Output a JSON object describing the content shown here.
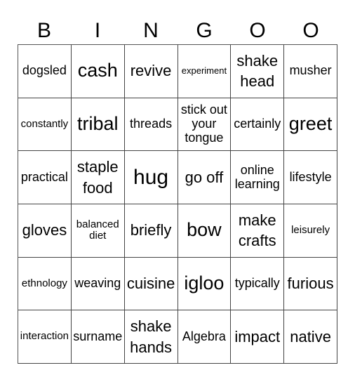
{
  "header": [
    "B",
    "I",
    "N",
    "G",
    "O",
    "O"
  ],
  "cells": [
    [
      "dogsled",
      "cash",
      "revive",
      "experiment",
      "shake head",
      "musher"
    ],
    [
      "constantly",
      "tribal",
      "threads",
      "stick out your tongue",
      "certainly",
      "greet"
    ],
    [
      "practical",
      "staple food",
      "hug",
      "go off",
      "online learning",
      "lifestyle"
    ],
    [
      "gloves",
      "balanced diet",
      "briefly",
      "bow",
      "make crafts",
      "leisurely"
    ],
    [
      "ethnology",
      "weaving",
      "cuisine",
      "igloo",
      "typically",
      "furious"
    ],
    [
      "interaction",
      "surname",
      "shake hands",
      "Algebra",
      "impact",
      "native"
    ]
  ]
}
